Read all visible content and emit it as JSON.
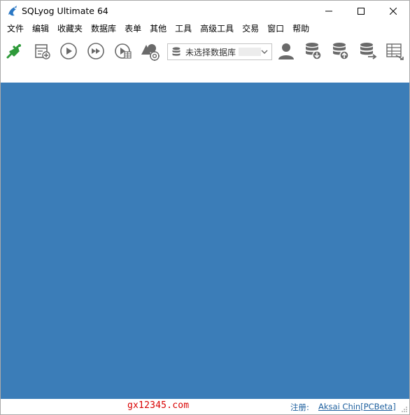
{
  "window": {
    "title": "SQLyog Ultimate 64",
    "icon": "dolphin-icon"
  },
  "menu": [
    {
      "label": "文件"
    },
    {
      "label": "编辑"
    },
    {
      "label": "收藏夹"
    },
    {
      "label": "数据库"
    },
    {
      "label": "表单"
    },
    {
      "label": "其他"
    },
    {
      "label": "工具"
    },
    {
      "label": "高级工具"
    },
    {
      "label": "交易"
    },
    {
      "label": "窗口"
    },
    {
      "label": "帮助"
    }
  ],
  "toolbar": {
    "db_select": {
      "value": "未选择数据库"
    }
  },
  "colors": {
    "main_background": "#3b7db8",
    "connect_green": "#2e9a3a",
    "icon_gray": "#6a6a6a",
    "watermark": "#d90000",
    "link": "#1d5f9e"
  },
  "statusbar": {
    "watermark": "gx12345.com",
    "registered_label": "注册:",
    "registered_name": "Aksai Chin[PCBeta]"
  }
}
